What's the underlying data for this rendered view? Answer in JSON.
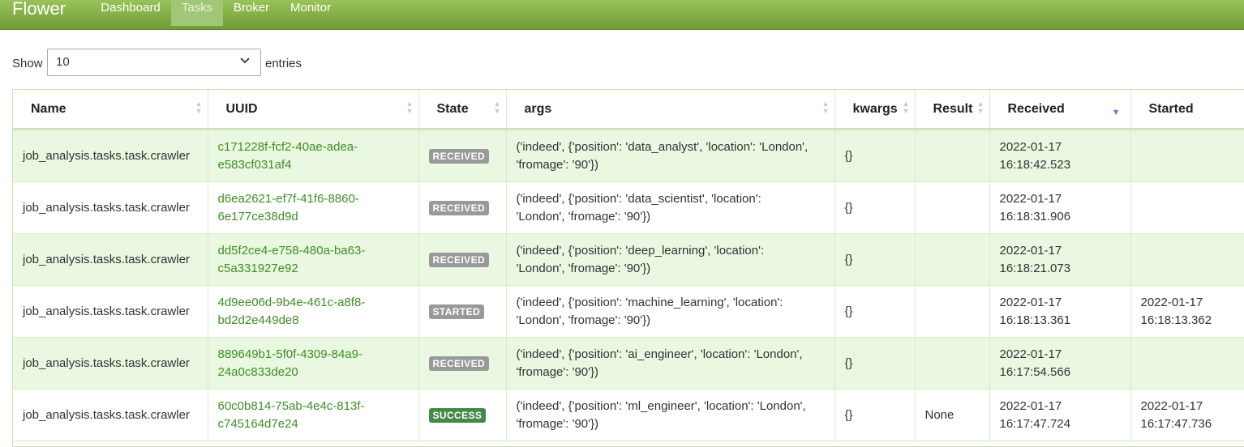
{
  "nav": {
    "brand": "Flower",
    "items": [
      {
        "label": "Dashboard"
      },
      {
        "label": "Tasks"
      },
      {
        "label": "Broker"
      },
      {
        "label": "Monitor"
      }
    ]
  },
  "length_menu": {
    "show_label": "Show",
    "value": "10",
    "entries_label": "entries"
  },
  "table": {
    "columns": [
      "Name",
      "UUID",
      "State",
      "args",
      "kwargs",
      "Result",
      "Received",
      "Started"
    ],
    "sorted_column": "Received",
    "rows": [
      {
        "name": "job_analysis.tasks.task.crawler",
        "uuid_1": "c171228f-fcf2-40ae-adea-",
        "uuid_2": "e583cf031af4",
        "state": "RECEIVED",
        "args_1": "('indeed', {'position': 'data_analyst', 'location': 'London',",
        "args_2": "'fromage': '90'})",
        "kwargs": "{}",
        "result": "",
        "received_1": "2022-01-17",
        "received_2": "16:18:42.523",
        "started_1": "",
        "started_2": ""
      },
      {
        "name": "job_analysis.tasks.task.crawler",
        "uuid_1": "d6ea2621-ef7f-41f6-8860-",
        "uuid_2": "6e177ce38d9d",
        "state": "RECEIVED",
        "args_1": "('indeed', {'position': 'data_scientist', 'location':",
        "args_2": "'London', 'fromage': '90'})",
        "kwargs": "{}",
        "result": "",
        "received_1": "2022-01-17",
        "received_2": "16:18:31.906",
        "started_1": "",
        "started_2": ""
      },
      {
        "name": "job_analysis.tasks.task.crawler",
        "uuid_1": "dd5f2ce4-e758-480a-ba63-",
        "uuid_2": "c5a331927e92",
        "state": "RECEIVED",
        "args_1": "('indeed', {'position': 'deep_learning', 'location':",
        "args_2": "'London', 'fromage': '90'})",
        "kwargs": "{}",
        "result": "",
        "received_1": "2022-01-17",
        "received_2": "16:18:21.073",
        "started_1": "",
        "started_2": ""
      },
      {
        "name": "job_analysis.tasks.task.crawler",
        "uuid_1": "4d9ee06d-9b4e-461c-a8f8-",
        "uuid_2": "bd2d2e449de8",
        "state": "STARTED",
        "args_1": "('indeed', {'position': 'machine_learning', 'location':",
        "args_2": "'London', 'fromage': '90'})",
        "kwargs": "{}",
        "result": "",
        "received_1": "2022-01-17",
        "received_2": "16:18:13.361",
        "started_1": "2022-01-17",
        "started_2": "16:18:13.362"
      },
      {
        "name": "job_analysis.tasks.task.crawler",
        "uuid_1": "889649b1-5f0f-4309-84a9-",
        "uuid_2": "24a0c833de20",
        "state": "RECEIVED",
        "args_1": "('indeed', {'position': 'ai_engineer', 'location': 'London',",
        "args_2": "'fromage': '90'})",
        "kwargs": "{}",
        "result": "",
        "received_1": "2022-01-17",
        "received_2": "16:17:54.566",
        "started_1": "",
        "started_2": ""
      },
      {
        "name": "job_analysis.tasks.task.crawler",
        "uuid_1": "60c0b814-75ab-4e4c-813f-",
        "uuid_2": "c745164d7e24",
        "state": "SUCCESS",
        "args_1": "('indeed', {'position': 'ml_engineer', 'location': 'London',",
        "args_2": "'fromage': '90'})",
        "kwargs": "{}",
        "result": "None",
        "received_1": "2022-01-17",
        "received_2": "16:17:47.724",
        "started_1": "2022-01-17",
        "started_2": "16:17:47.736"
      }
    ]
  },
  "colors": {
    "navbar_top": "#9ac25a",
    "navbar_bottom": "#6f9c34",
    "uuid_link": "#3f8f24",
    "row_striped": "#eaf7e1",
    "badge_received": "#999999",
    "badge_success": "#468847",
    "sort_desc": "#5b7fc8"
  },
  "icons": {
    "select_caret": "chevron-down-icon",
    "sort_both": "sort-both-icon",
    "sort_desc": "sort-desc-icon"
  }
}
